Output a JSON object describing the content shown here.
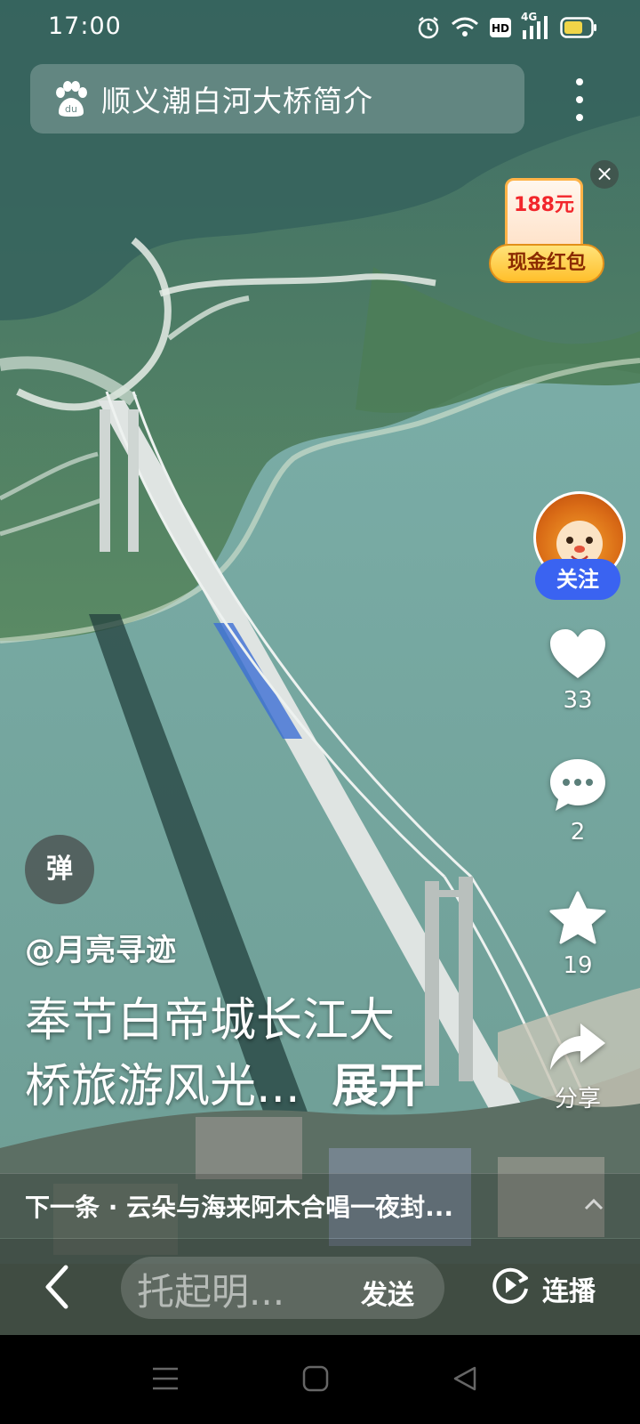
{
  "status_bar": {
    "time": "17:00",
    "network": "4G",
    "hd": "HD"
  },
  "search": {
    "query": "顺义潮白河大桥简介"
  },
  "red_packet": {
    "amount": "188元",
    "label": "现金红包"
  },
  "creator": {
    "follow_label": "关注",
    "handle": "@月亮寻迹"
  },
  "actions": {
    "likes": "33",
    "comments": "2",
    "favorites": "19",
    "share_label": "分享"
  },
  "danmaku_label": "弹",
  "caption": {
    "line1": "奉节白帝城长江大",
    "line2": "桥旅游风光...",
    "expand_label": "展开"
  },
  "next_video": {
    "text": "下一条 · 云朵与海来阿木合唱一夜封..."
  },
  "bottom_bar": {
    "input_placeholder": "托起明...",
    "send_label": "发送",
    "autoplay_label": "连播"
  },
  "colors": {
    "accent_blue": "#3a63f1",
    "packet_red": "#f2262b",
    "packet_gold": "#ffbf2b"
  }
}
